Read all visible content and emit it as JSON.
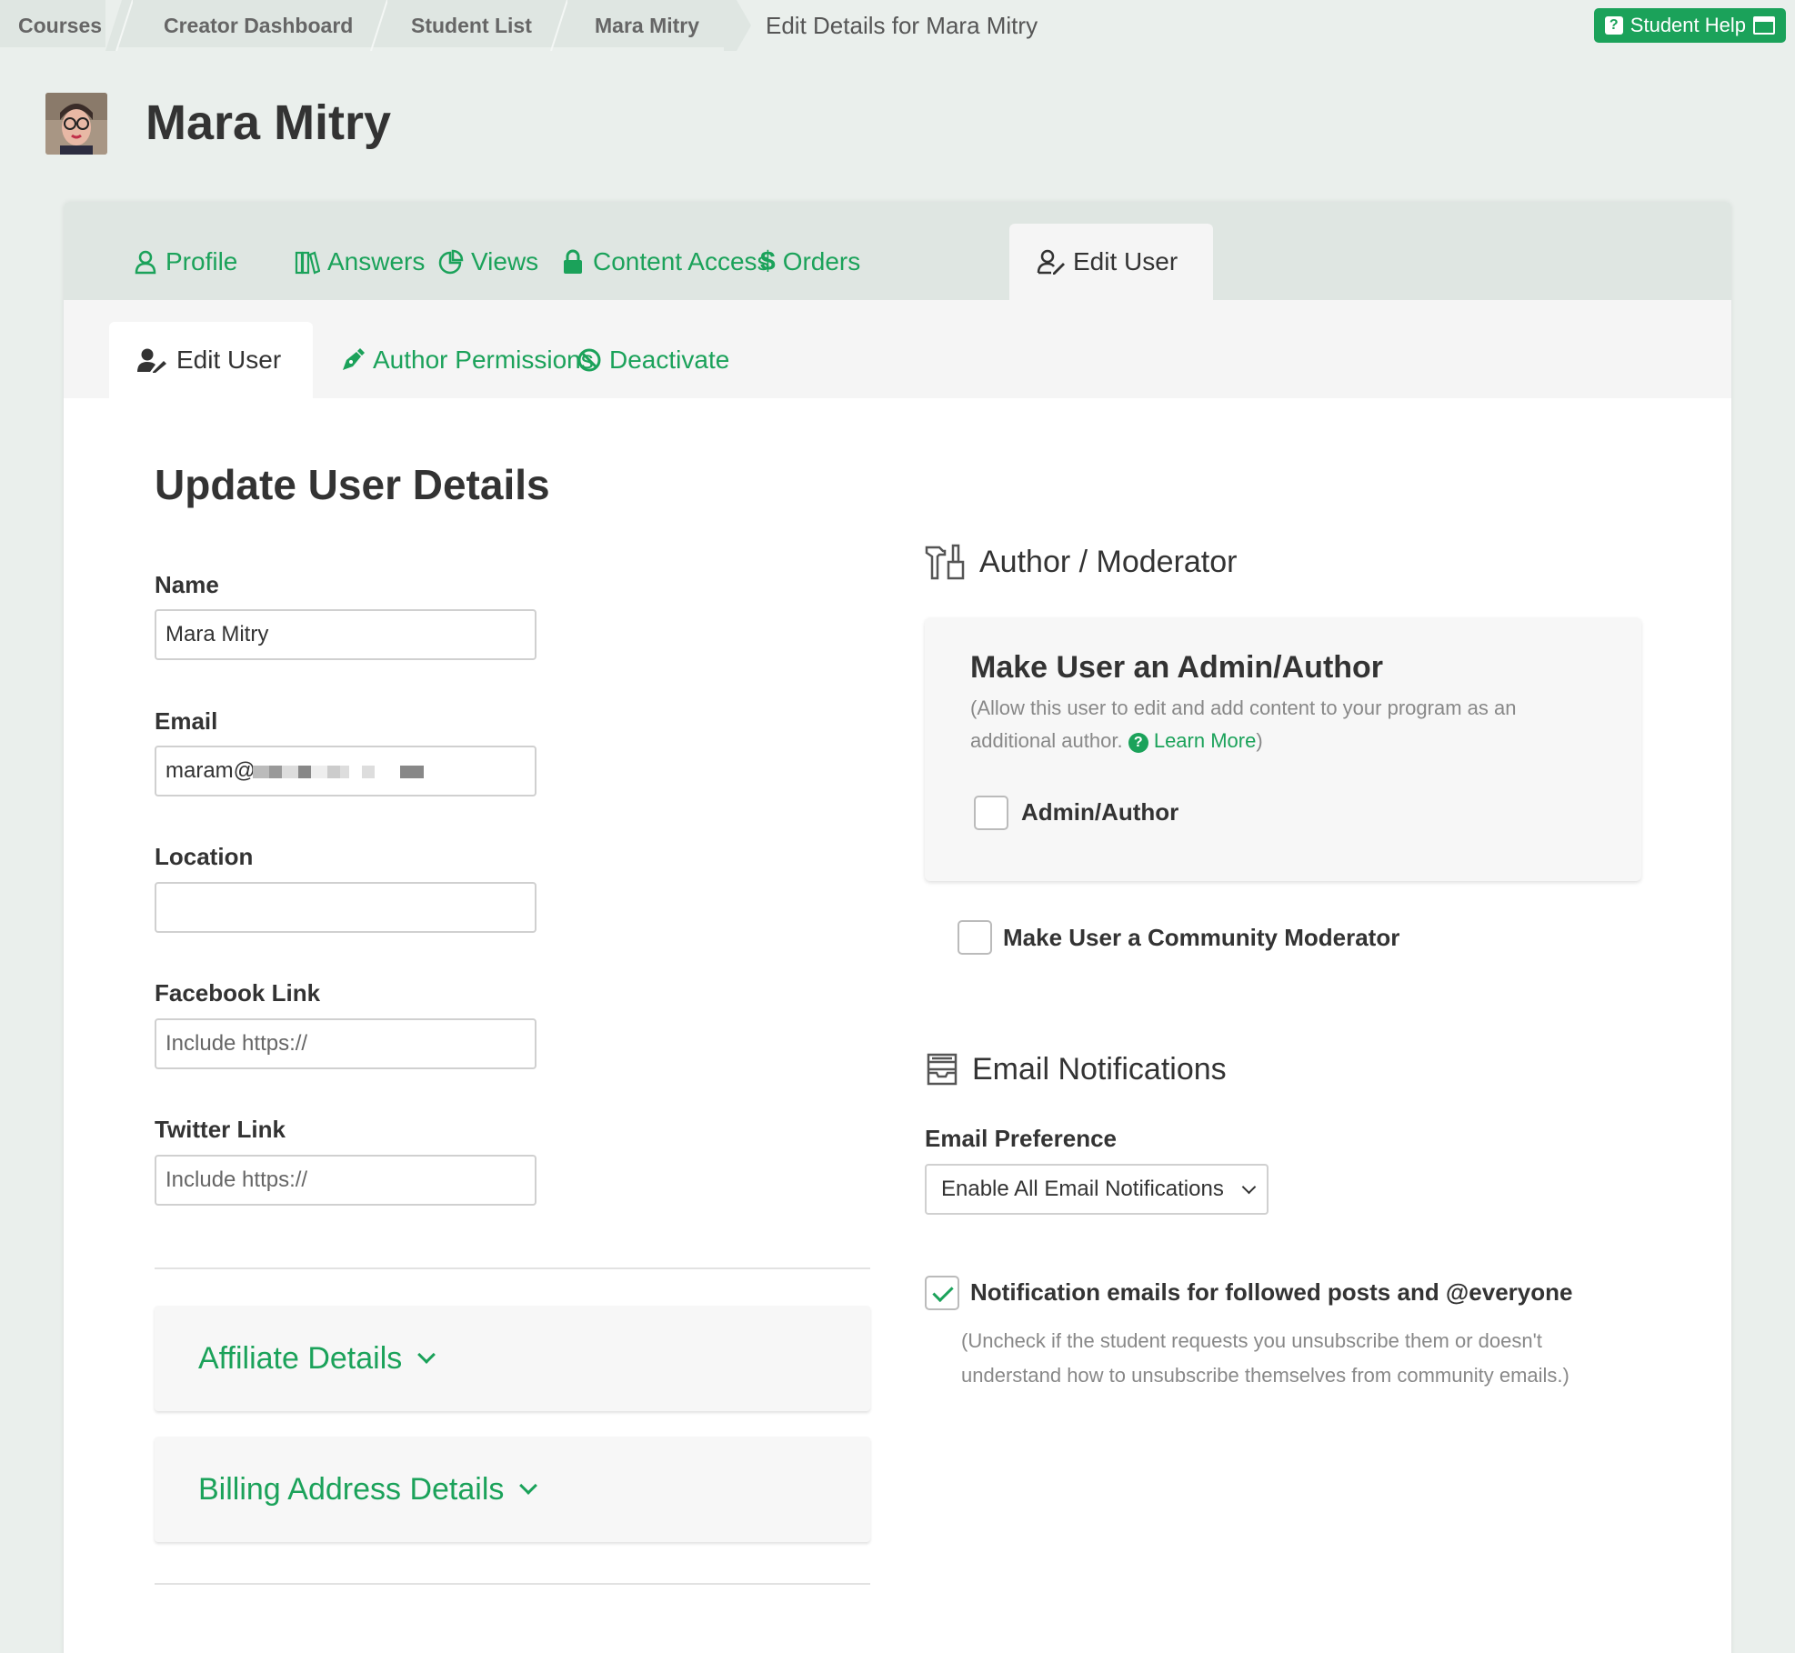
{
  "breadcrumb": {
    "items": [
      "Courses",
      "Creator Dashboard",
      "Student List",
      "Mara Mitry"
    ],
    "current": "Edit Details for Mara Mitry"
  },
  "student_help": {
    "label": "Student Help",
    "icon": "question-icon"
  },
  "header": {
    "name": "Mara Mitry"
  },
  "main_tabs": [
    {
      "label": "Profile",
      "icon": "user-icon"
    },
    {
      "label": "Answers",
      "icon": "books-icon"
    },
    {
      "label": "Views",
      "icon": "pie-chart-icon"
    },
    {
      "label": "Content Access",
      "icon": "lock-icon"
    },
    {
      "label": "Orders",
      "icon": "dollar-icon"
    },
    {
      "label": "Edit User",
      "icon": "user-edit-icon",
      "active": true
    }
  ],
  "sub_tabs": [
    {
      "label": "Edit User",
      "icon": "user-edit-icon",
      "active": true
    },
    {
      "label": "Author Permissions",
      "icon": "pen-icon"
    },
    {
      "label": "Deactivate",
      "icon": "ban-icon"
    }
  ],
  "form": {
    "title": "Update User Details",
    "name": {
      "label": "Name",
      "value": "Mara Mitry"
    },
    "email": {
      "label": "Email",
      "value": "maram@"
    },
    "location": {
      "label": "Location",
      "value": ""
    },
    "facebook": {
      "label": "Facebook Link",
      "placeholder": "Include https://"
    },
    "twitter": {
      "label": "Twitter Link",
      "placeholder": "Include https://"
    }
  },
  "accordions": {
    "affiliate": "Affiliate Details",
    "billing": "Billing Address Details"
  },
  "author_moderator": {
    "heading": "Author / Moderator",
    "admin_title": "Make User an Admin/Author",
    "admin_desc": "(Allow this user to edit and add content to your program as an additional author.",
    "learn_more": "Learn More",
    "admin_desc_close": ")",
    "admin_checkbox": {
      "label": "Admin/Author",
      "checked": false
    },
    "moderator_checkbox": {
      "label": "Make User a Community Moderator",
      "checked": false
    }
  },
  "email_notifications": {
    "heading": "Email Notifications",
    "preference_label": "Email Preference",
    "preference_value": "Enable All Email Notifications",
    "followed_checkbox": {
      "label": "Notification emails for followed posts and @everyone",
      "checked": true
    },
    "note": "(Uncheck if the student requests you unsubscribe them or doesn't understand how to unsubscribe themselves from community emails.)"
  },
  "colors": {
    "accent": "#1ba25a",
    "page_bg": "#eaefec",
    "tab_bg": "#dfe6e2"
  }
}
